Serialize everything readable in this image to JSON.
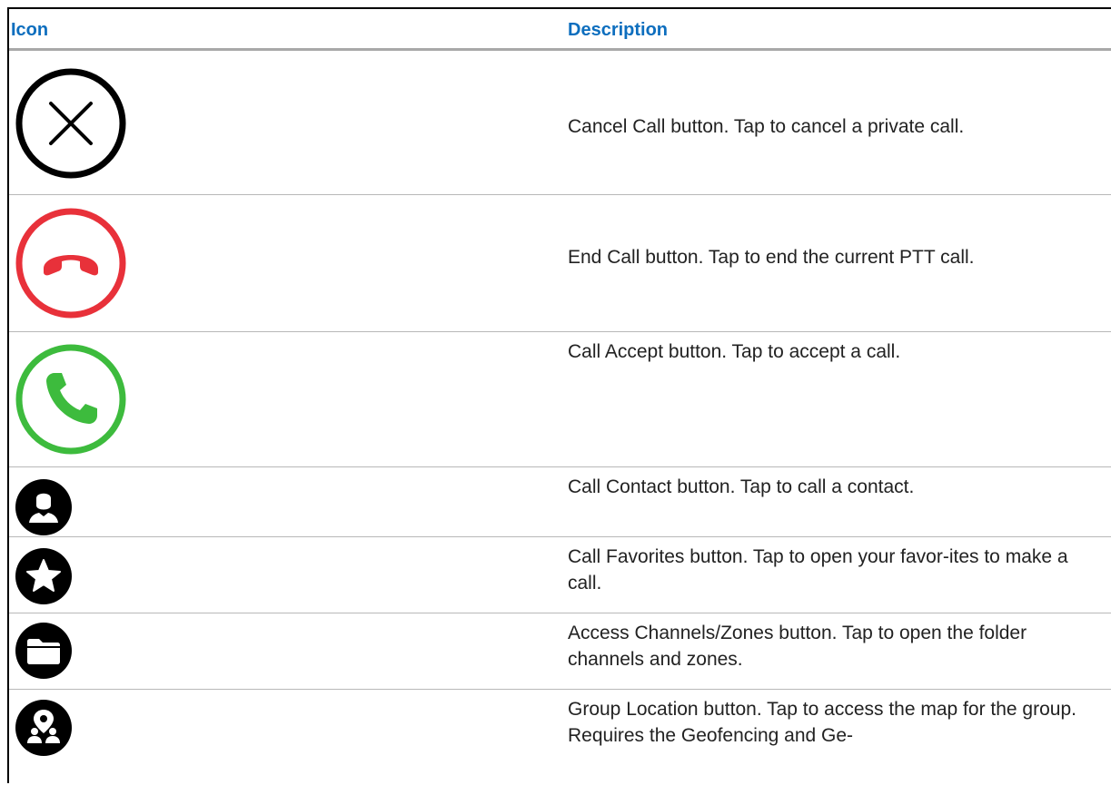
{
  "table": {
    "header": {
      "icon": "Icon",
      "description": "Description"
    },
    "rows": [
      {
        "icon": "cancel-call-icon",
        "description": "Cancel Call button. Tap to cancel a private call."
      },
      {
        "icon": "end-call-icon",
        "description": "End Call button. Tap to end the current PTT call."
      },
      {
        "icon": "call-accept-icon",
        "description": "Call Accept button. Tap to accept a call."
      },
      {
        "icon": "call-contact-icon",
        "description": "Call Contact button. Tap to call a contact."
      },
      {
        "icon": "call-favorites-icon",
        "description": "Call Favorites button. Tap to open your favor-ites to make a call."
      },
      {
        "icon": "channels-zones-icon",
        "description": "Access Channels/Zones button. Tap to open the folder channels and zones."
      },
      {
        "icon": "group-location-icon",
        "description": "Group Location button. Tap to access the map for the group. Requires the Geofencing and Ge-"
      }
    ]
  },
  "colors": {
    "header_text": "#0d6ebe",
    "header_rule": "#a8a8a8",
    "row_rule": "#b8b8b8",
    "end_call": "#e8313a",
    "accept_call": "#3dbb3d"
  }
}
